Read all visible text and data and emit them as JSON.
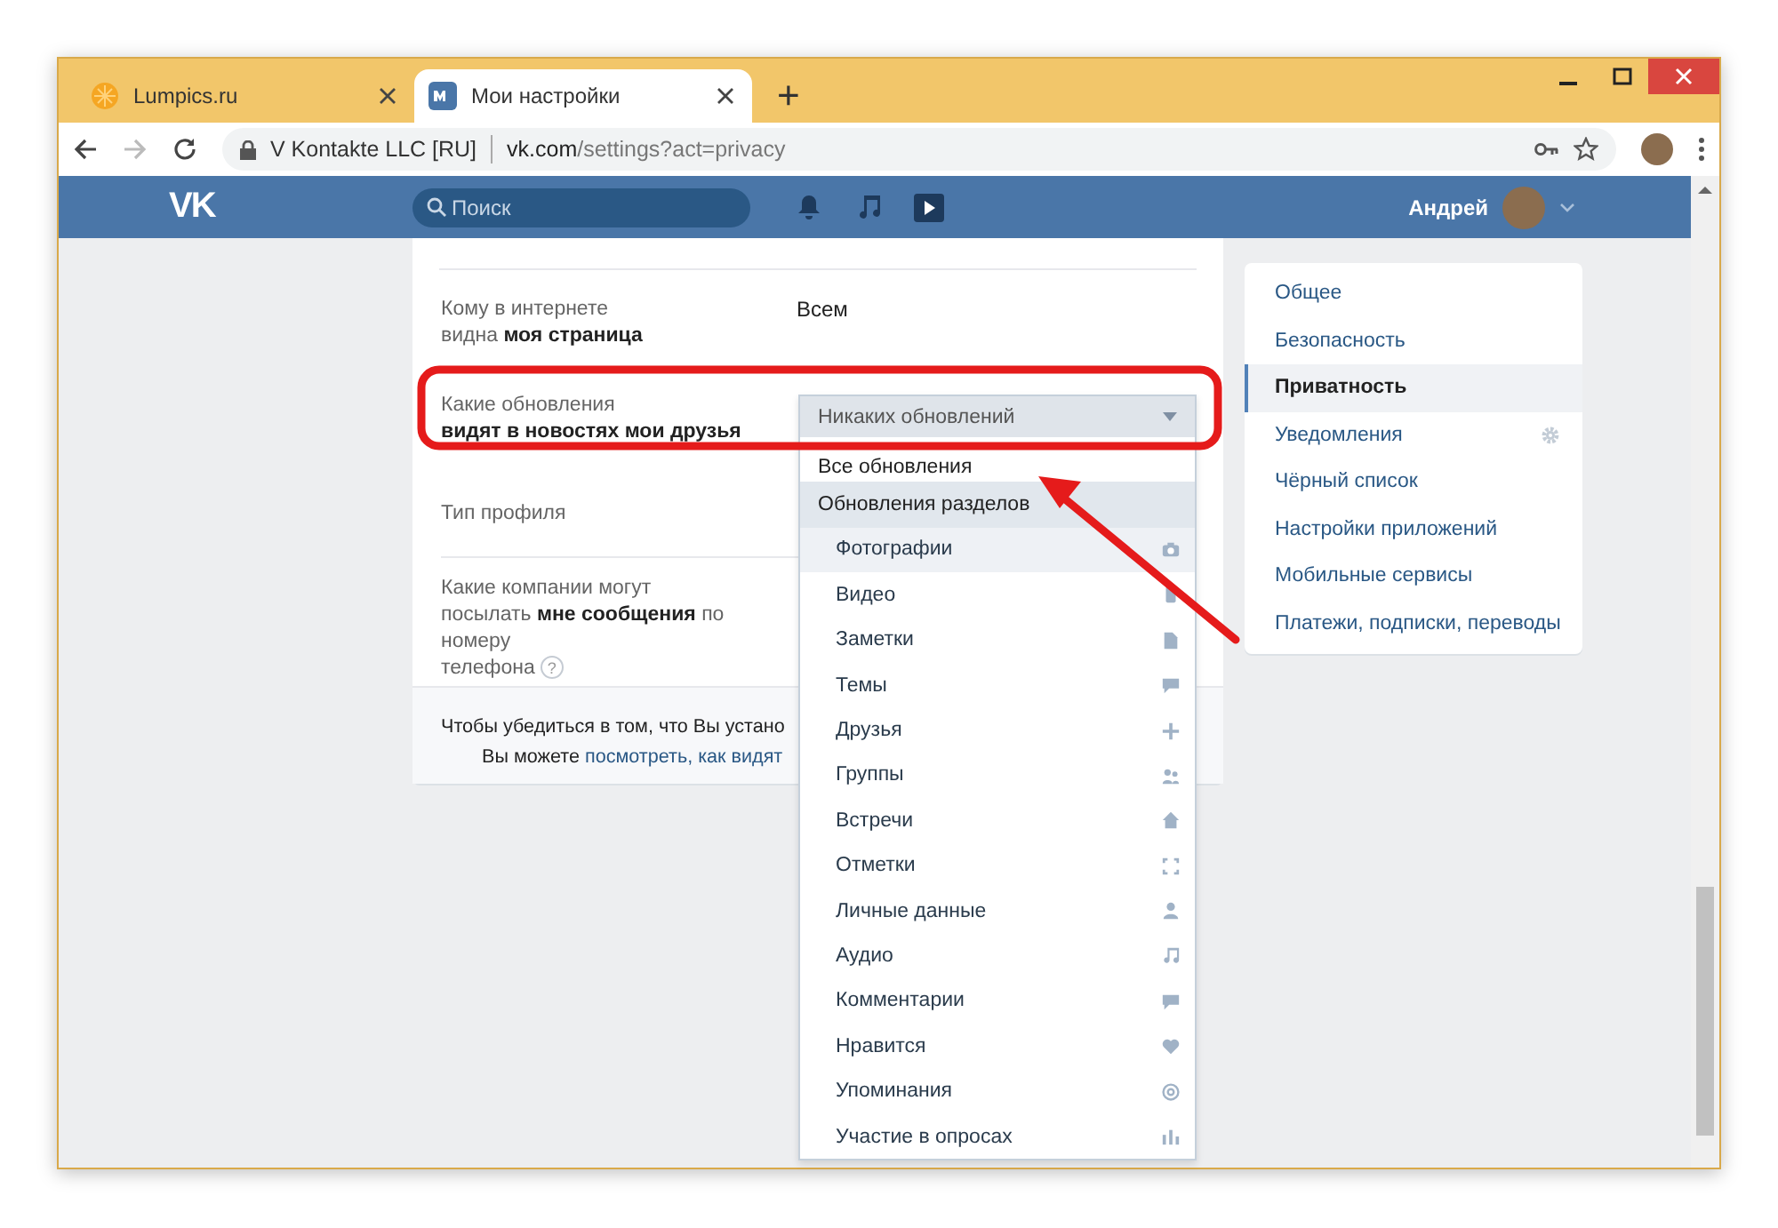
{
  "browser": {
    "tabs": [
      {
        "title": "Lumpics.ru",
        "selected": false
      },
      {
        "title": "Мои настройки",
        "selected": true
      }
    ],
    "new_tab": "+",
    "security": "V Kontakte LLC [RU]",
    "url_host": "vk.com",
    "url_path": "/settings?act=privacy"
  },
  "header": {
    "logo": "VK",
    "search": {
      "placeholder": "Поиск"
    },
    "user": "Андрей"
  },
  "settings": [
    {
      "label": [
        "Кому в интернете",
        "видна **моя страница**"
      ],
      "value": "Всем"
    },
    {
      "label": [
        "Какие обновления",
        "**видят в новостях мои друзья**"
      ]
    },
    {
      "label": [
        "Тип профиля"
      ]
    },
    {
      "label": [
        "Какие компании могут",
        "посылать **мне сообщения** по номеру",
        "телефона"
      ],
      "help": "?"
    }
  ],
  "footer": {
    "text_1": "Чтобы убедиться в том, что Вы устано",
    "text_2": "Вы можете ",
    "link": "посмотреть, как видят"
  },
  "dropdown": {
    "value": "Никаких обновлений",
    "options": [
      {
        "label": "Все обновления",
        "kind": "option",
        "selected": false
      },
      {
        "label": "Обновления разделов",
        "kind": "group",
        "selected": true
      },
      {
        "label": "Фотографии",
        "kind": "sub",
        "selected": true
      },
      {
        "label": "Видео",
        "kind": "sub",
        "selected": false
      },
      {
        "label": "Заметки",
        "kind": "sub",
        "selected": false
      },
      {
        "label": "Темы",
        "kind": "sub",
        "selected": false
      },
      {
        "label": "Друзья",
        "kind": "sub",
        "selected": false
      },
      {
        "label": "Группы",
        "kind": "sub",
        "selected": false
      },
      {
        "label": "Встречи",
        "kind": "sub",
        "selected": false
      },
      {
        "label": "Отметки",
        "kind": "sub",
        "selected": false
      },
      {
        "label": "Личные данные",
        "kind": "sub",
        "selected": false
      },
      {
        "label": "Аудио",
        "kind": "sub",
        "selected": false
      },
      {
        "label": "Комментарии",
        "kind": "sub",
        "selected": false
      },
      {
        "label": "Нравится",
        "kind": "sub",
        "selected": false
      },
      {
        "label": "Упоминания",
        "kind": "sub",
        "selected": false
      },
      {
        "label": "Участие в опросах",
        "kind": "sub",
        "selected": false
      }
    ]
  },
  "menu": [
    {
      "label": "Общее",
      "selected": false,
      "gear": false
    },
    {
      "label": "Безопасность",
      "selected": false,
      "gear": false
    },
    {
      "label": "Приватность",
      "selected": true,
      "gear": false
    },
    {
      "label": "Уведомления",
      "selected": false,
      "gear": true
    },
    {
      "label": "Чёрный список",
      "selected": false,
      "gear": false
    },
    {
      "label": "Настройки приложений",
      "selected": false,
      "gear": false
    },
    {
      "label": "Мобильные сервисы",
      "selected": false,
      "gear": false
    },
    {
      "label": "Платежи, подписки, переводы",
      "selected": false,
      "gear": false
    }
  ]
}
